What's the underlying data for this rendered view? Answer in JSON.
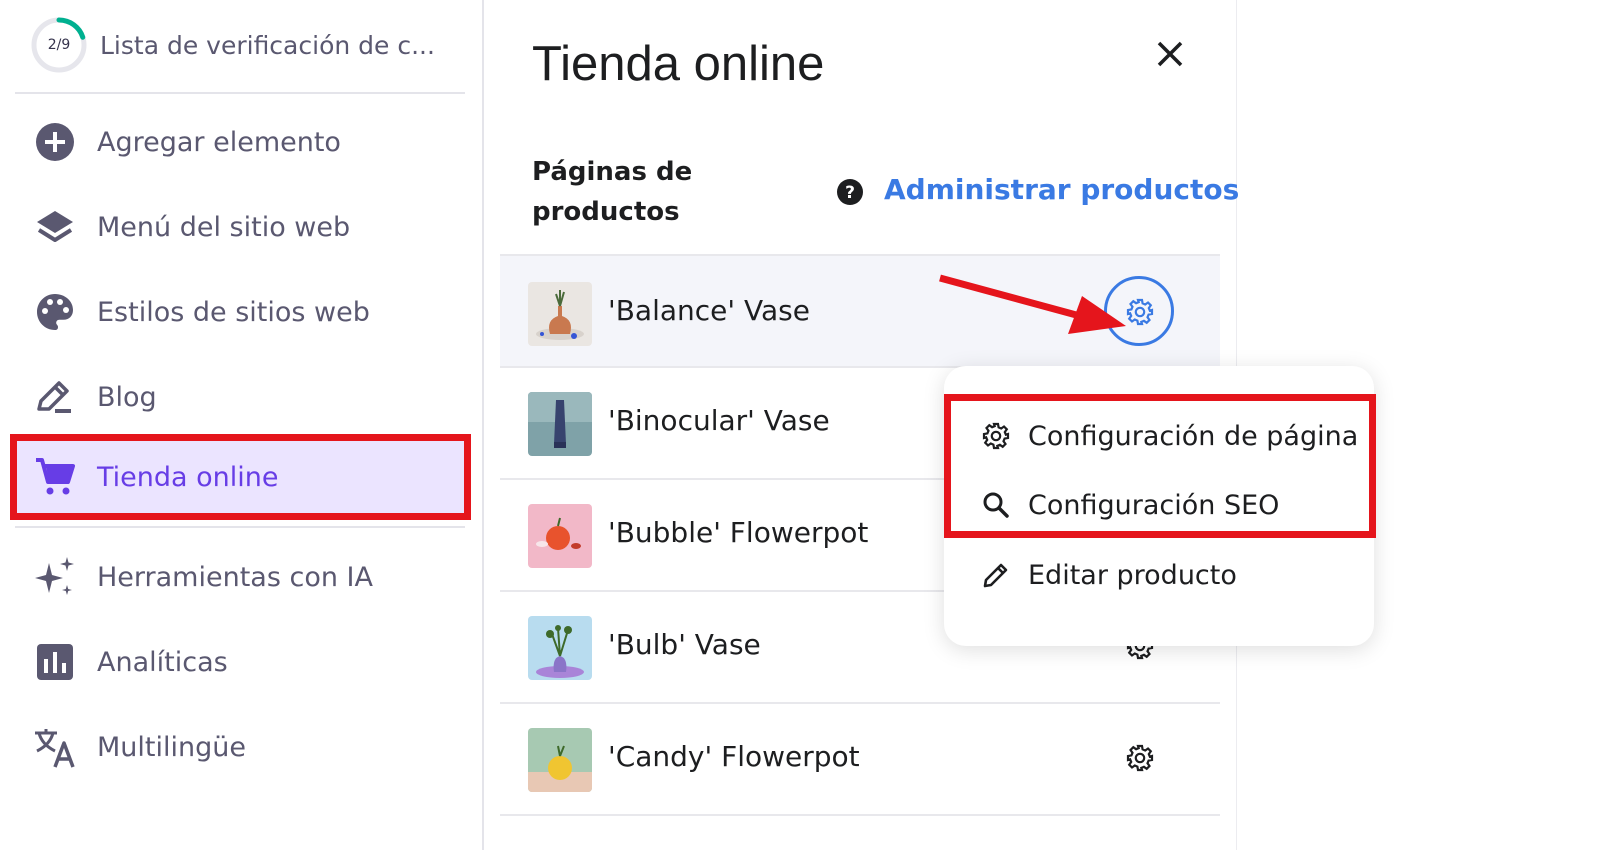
{
  "sidebar": {
    "checklist": {
      "progress_text": "2/9",
      "progress": 0.222,
      "title": "Lista de verificación de c..."
    },
    "items": [
      {
        "label": "Agregar elemento",
        "icon": "plus-circle-icon"
      },
      {
        "label": "Menú del sitio web",
        "icon": "layers-icon"
      },
      {
        "label": "Estilos de sitios web",
        "icon": "palette-icon"
      },
      {
        "label": "Blog",
        "icon": "edit-pen-icon"
      },
      {
        "label": "Tienda online",
        "icon": "shopping-cart-icon",
        "active": true
      },
      {
        "label": "Herramientas con IA",
        "icon": "sparkles-icon"
      },
      {
        "label": "Analíticas",
        "icon": "bar-chart-icon"
      },
      {
        "label": "Multilingüe",
        "icon": "translate-icon"
      }
    ]
  },
  "panel": {
    "title": "Tienda online",
    "section_label": "Páginas de productos",
    "manage_link": "Administrar productos",
    "products": [
      {
        "name": "'Balance' Vase"
      },
      {
        "name": "'Binocular' Vase"
      },
      {
        "name": "'Bubble' Flowerpot"
      },
      {
        "name": "'Bulb' Vase"
      },
      {
        "name": "'Candy' Flowerpot"
      }
    ]
  },
  "dropdown": {
    "items": [
      {
        "label": "Configuración de página",
        "icon": "gear-icon"
      },
      {
        "label": "Configuración SEO",
        "icon": "search-icon"
      },
      {
        "label": "Editar producto",
        "icon": "pencil-icon"
      }
    ]
  },
  "colors": {
    "accent": "#673de6",
    "link": "#3a7ae3",
    "highlight": "#e5151c",
    "active_bg": "#ebe4ff"
  }
}
